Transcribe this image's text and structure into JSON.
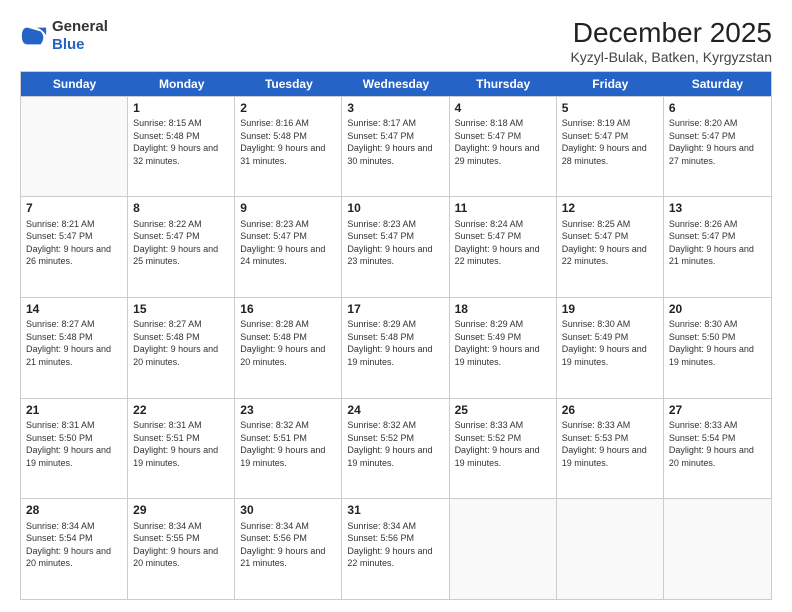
{
  "logo": {
    "line1": "General",
    "line2": "Blue"
  },
  "title": "December 2025",
  "subtitle": "Kyzyl-Bulak, Batken, Kyrgyzstan",
  "days": [
    "Sunday",
    "Monday",
    "Tuesday",
    "Wednesday",
    "Thursday",
    "Friday",
    "Saturday"
  ],
  "rows": [
    [
      {
        "day": "",
        "sunrise": "",
        "sunset": "",
        "daylight": ""
      },
      {
        "day": "1",
        "sunrise": "Sunrise: 8:15 AM",
        "sunset": "Sunset: 5:48 PM",
        "daylight": "Daylight: 9 hours and 32 minutes."
      },
      {
        "day": "2",
        "sunrise": "Sunrise: 8:16 AM",
        "sunset": "Sunset: 5:48 PM",
        "daylight": "Daylight: 9 hours and 31 minutes."
      },
      {
        "day": "3",
        "sunrise": "Sunrise: 8:17 AM",
        "sunset": "Sunset: 5:47 PM",
        "daylight": "Daylight: 9 hours and 30 minutes."
      },
      {
        "day": "4",
        "sunrise": "Sunrise: 8:18 AM",
        "sunset": "Sunset: 5:47 PM",
        "daylight": "Daylight: 9 hours and 29 minutes."
      },
      {
        "day": "5",
        "sunrise": "Sunrise: 8:19 AM",
        "sunset": "Sunset: 5:47 PM",
        "daylight": "Daylight: 9 hours and 28 minutes."
      },
      {
        "day": "6",
        "sunrise": "Sunrise: 8:20 AM",
        "sunset": "Sunset: 5:47 PM",
        "daylight": "Daylight: 9 hours and 27 minutes."
      }
    ],
    [
      {
        "day": "7",
        "sunrise": "Sunrise: 8:21 AM",
        "sunset": "Sunset: 5:47 PM",
        "daylight": "Daylight: 9 hours and 26 minutes."
      },
      {
        "day": "8",
        "sunrise": "Sunrise: 8:22 AM",
        "sunset": "Sunset: 5:47 PM",
        "daylight": "Daylight: 9 hours and 25 minutes."
      },
      {
        "day": "9",
        "sunrise": "Sunrise: 8:23 AM",
        "sunset": "Sunset: 5:47 PM",
        "daylight": "Daylight: 9 hours and 24 minutes."
      },
      {
        "day": "10",
        "sunrise": "Sunrise: 8:23 AM",
        "sunset": "Sunset: 5:47 PM",
        "daylight": "Daylight: 9 hours and 23 minutes."
      },
      {
        "day": "11",
        "sunrise": "Sunrise: 8:24 AM",
        "sunset": "Sunset: 5:47 PM",
        "daylight": "Daylight: 9 hours and 22 minutes."
      },
      {
        "day": "12",
        "sunrise": "Sunrise: 8:25 AM",
        "sunset": "Sunset: 5:47 PM",
        "daylight": "Daylight: 9 hours and 22 minutes."
      },
      {
        "day": "13",
        "sunrise": "Sunrise: 8:26 AM",
        "sunset": "Sunset: 5:47 PM",
        "daylight": "Daylight: 9 hours and 21 minutes."
      }
    ],
    [
      {
        "day": "14",
        "sunrise": "Sunrise: 8:27 AM",
        "sunset": "Sunset: 5:48 PM",
        "daylight": "Daylight: 9 hours and 21 minutes."
      },
      {
        "day": "15",
        "sunrise": "Sunrise: 8:27 AM",
        "sunset": "Sunset: 5:48 PM",
        "daylight": "Daylight: 9 hours and 20 minutes."
      },
      {
        "day": "16",
        "sunrise": "Sunrise: 8:28 AM",
        "sunset": "Sunset: 5:48 PM",
        "daylight": "Daylight: 9 hours and 20 minutes."
      },
      {
        "day": "17",
        "sunrise": "Sunrise: 8:29 AM",
        "sunset": "Sunset: 5:48 PM",
        "daylight": "Daylight: 9 hours and 19 minutes."
      },
      {
        "day": "18",
        "sunrise": "Sunrise: 8:29 AM",
        "sunset": "Sunset: 5:49 PM",
        "daylight": "Daylight: 9 hours and 19 minutes."
      },
      {
        "day": "19",
        "sunrise": "Sunrise: 8:30 AM",
        "sunset": "Sunset: 5:49 PM",
        "daylight": "Daylight: 9 hours and 19 minutes."
      },
      {
        "day": "20",
        "sunrise": "Sunrise: 8:30 AM",
        "sunset": "Sunset: 5:50 PM",
        "daylight": "Daylight: 9 hours and 19 minutes."
      }
    ],
    [
      {
        "day": "21",
        "sunrise": "Sunrise: 8:31 AM",
        "sunset": "Sunset: 5:50 PM",
        "daylight": "Daylight: 9 hours and 19 minutes."
      },
      {
        "day": "22",
        "sunrise": "Sunrise: 8:31 AM",
        "sunset": "Sunset: 5:51 PM",
        "daylight": "Daylight: 9 hours and 19 minutes."
      },
      {
        "day": "23",
        "sunrise": "Sunrise: 8:32 AM",
        "sunset": "Sunset: 5:51 PM",
        "daylight": "Daylight: 9 hours and 19 minutes."
      },
      {
        "day": "24",
        "sunrise": "Sunrise: 8:32 AM",
        "sunset": "Sunset: 5:52 PM",
        "daylight": "Daylight: 9 hours and 19 minutes."
      },
      {
        "day": "25",
        "sunrise": "Sunrise: 8:33 AM",
        "sunset": "Sunset: 5:52 PM",
        "daylight": "Daylight: 9 hours and 19 minutes."
      },
      {
        "day": "26",
        "sunrise": "Sunrise: 8:33 AM",
        "sunset": "Sunset: 5:53 PM",
        "daylight": "Daylight: 9 hours and 19 minutes."
      },
      {
        "day": "27",
        "sunrise": "Sunrise: 8:33 AM",
        "sunset": "Sunset: 5:54 PM",
        "daylight": "Daylight: 9 hours and 20 minutes."
      }
    ],
    [
      {
        "day": "28",
        "sunrise": "Sunrise: 8:34 AM",
        "sunset": "Sunset: 5:54 PM",
        "daylight": "Daylight: 9 hours and 20 minutes."
      },
      {
        "day": "29",
        "sunrise": "Sunrise: 8:34 AM",
        "sunset": "Sunset: 5:55 PM",
        "daylight": "Daylight: 9 hours and 20 minutes."
      },
      {
        "day": "30",
        "sunrise": "Sunrise: 8:34 AM",
        "sunset": "Sunset: 5:56 PM",
        "daylight": "Daylight: 9 hours and 21 minutes."
      },
      {
        "day": "31",
        "sunrise": "Sunrise: 8:34 AM",
        "sunset": "Sunset: 5:56 PM",
        "daylight": "Daylight: 9 hours and 22 minutes."
      },
      {
        "day": "",
        "sunrise": "",
        "sunset": "",
        "daylight": ""
      },
      {
        "day": "",
        "sunrise": "",
        "sunset": "",
        "daylight": ""
      },
      {
        "day": "",
        "sunrise": "",
        "sunset": "",
        "daylight": ""
      }
    ]
  ]
}
